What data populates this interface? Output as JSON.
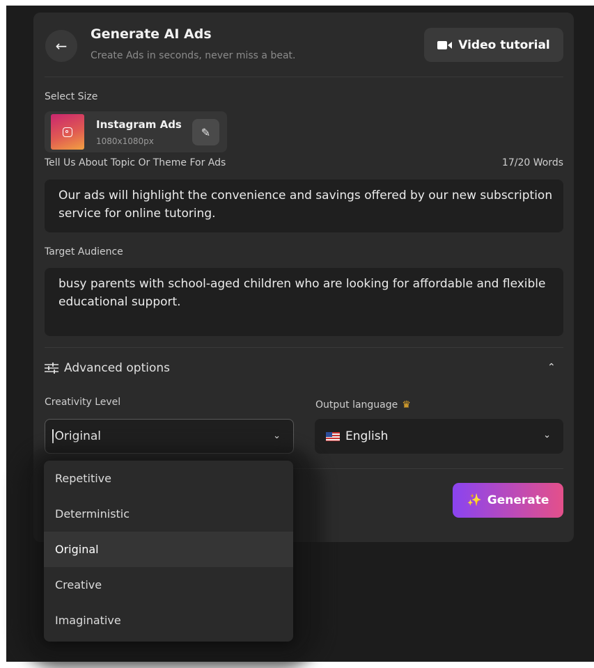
{
  "header": {
    "back_icon": "arrow-left-icon",
    "title": "Generate AI Ads",
    "subtitle": "Create Ads in seconds, never miss a beat.",
    "video_button_label": "Video tutorial",
    "video_icon": "video-camera-icon"
  },
  "size": {
    "label": "Select Size",
    "name": "Instagram Ads",
    "dimensions": "1080x1080px",
    "icon": "instagram-icon",
    "edit_icon": "pencil-icon"
  },
  "topic": {
    "label": "Tell Us About Topic Or Theme For Ads",
    "word_count": "17/20 Words",
    "value": "Our ads will highlight the convenience and savings offered by our new subscription service for online tutoring."
  },
  "audience": {
    "label": "Target Audience",
    "value": "busy parents with school-aged children who are looking for affordable and flexible educational support."
  },
  "advanced": {
    "label": "Advanced options",
    "icon": "sliders-icon",
    "toggle_icon": "chevron-up-icon"
  },
  "creativity": {
    "label": "Creativity Level",
    "selected": "Original",
    "options": [
      "Repetitive",
      "Deterministic",
      "Original",
      "Creative",
      "Imaginative"
    ]
  },
  "language": {
    "label": "Output language",
    "premium_icon": "crown-icon",
    "selected": "English",
    "flag_icon": "us-flag-icon"
  },
  "generate": {
    "label": "Generate",
    "icon": "sparkles-icon"
  },
  "colors": {
    "accent_start": "#8a44f0",
    "accent_end": "#e4508a",
    "panel": "#2b2b2b"
  }
}
